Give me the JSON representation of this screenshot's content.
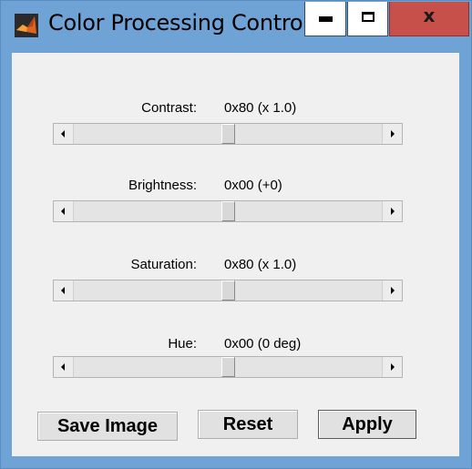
{
  "window": {
    "title": "Color Processing Control",
    "title_bar_color": "#6fa3d6",
    "close_button_color": "#c7504a",
    "close_label": "x",
    "app_icon": "matlab-icon"
  },
  "controls": [
    {
      "id": "contrast",
      "label": "Contrast:",
      "value": "0x80 (x 1.0)",
      "level": 0.5
    },
    {
      "id": "brightness",
      "label": "Brightness:",
      "value": "0x00 (+0)",
      "level": 0.5
    },
    {
      "id": "saturation",
      "label": "Saturation:",
      "value": "0x80 (x 1.0)",
      "level": 0.5
    },
    {
      "id": "hue",
      "label": "Hue:",
      "value": "0x00 (0 deg)",
      "level": 0.5
    }
  ],
  "buttons": {
    "save": "Save Image",
    "reset": "Reset",
    "apply": "Apply"
  }
}
